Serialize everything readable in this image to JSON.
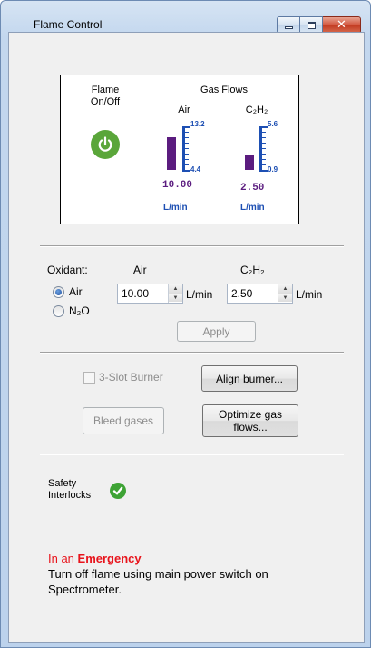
{
  "window": {
    "title": "Flame Control"
  },
  "status_panel": {
    "flame_label": "Flame\nOn/Off",
    "gas_flows_label": "Gas Flows",
    "air": {
      "label": "Air",
      "max": "13.2",
      "min": "4.4",
      "value": "10.00",
      "unit": "L/min",
      "fill": 0.63
    },
    "c2h2": {
      "label": "C₂H₂",
      "max": "5.6",
      "min": "0.9",
      "value": "2.50",
      "unit": "L/min",
      "fill": 0.34
    },
    "colors": {
      "bar": "#5b1c7f",
      "scale": "#1d4fb3",
      "power": "#5aa63a"
    }
  },
  "gas_settings": {
    "oxidant_label": "Oxidant:",
    "air_header": "Air",
    "c2h2_header": "C₂H₂",
    "oxidant_options": [
      {
        "label": "Air",
        "selected": true
      },
      {
        "label": "N₂O",
        "selected": false
      }
    ],
    "air_flow": "10.00",
    "c2h2_flow": "2.50",
    "unit": "L/min",
    "apply_label": "Apply"
  },
  "burner": {
    "three_slot_label": "3-Slot Burner",
    "align_label": "Align burner...",
    "bleed_label": "Bleed gases",
    "optimize_label": "Optimize gas\nflows..."
  },
  "safety": {
    "label": "Safety\nInterlocks"
  },
  "emergency": {
    "prefix": "In an ",
    "highlight": "Emergency",
    "message": "Turn off flame using main power switch on Spectrometer."
  }
}
